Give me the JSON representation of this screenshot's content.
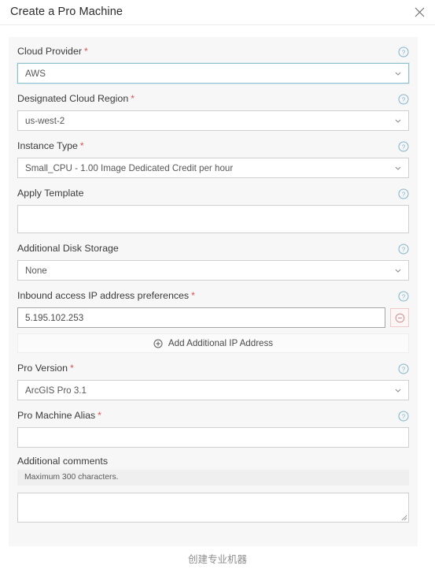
{
  "header": {
    "title": "Create a Pro Machine",
    "close_icon": "close-icon"
  },
  "colors": {
    "panel_background": "#f7f7f7",
    "page_background": "#ffffff",
    "required_asterisk": "#d9534f",
    "focused_border": "#8fc3d4",
    "help_icon": "#7fb5cc",
    "remove_button_border": "#f0c9c9",
    "remove_button_icon": "#d08a8a",
    "hint_background": "#efefef",
    "footer_text": "#8d8d8d"
  },
  "form": {
    "fields": [
      {
        "label": "Cloud Provider",
        "required": true,
        "required_mark": "*",
        "help_icon": "help-circle-icon",
        "type": "select",
        "value": "AWS",
        "focused": true
      },
      {
        "label": "Designated Cloud Region",
        "required": true,
        "required_mark": "*",
        "help_icon": "help-circle-icon",
        "type": "select",
        "value": "us-west-2",
        "focused": false
      },
      {
        "label": "Instance Type",
        "required": true,
        "required_mark": "*",
        "help_icon": "help-circle-icon",
        "type": "select",
        "value": "Small_CPU - 1.00 Image Dedicated Credit per hour",
        "focused": false
      },
      {
        "label": "Apply Template",
        "required": false,
        "required_mark": "",
        "help_icon": "help-circle-icon",
        "type": "textbox-tall",
        "value": "",
        "focused": false
      },
      {
        "label": "Additional Disk Storage",
        "required": false,
        "required_mark": "",
        "help_icon": "help-circle-icon",
        "type": "select",
        "value": "None",
        "focused": false
      }
    ],
    "ip_field": {
      "label": "Inbound access IP address preferences",
      "required": true,
      "required_mark": "*",
      "help_icon": "help-circle-icon",
      "value": "5.195.102.253",
      "remove_icon": "circle-minus-icon",
      "add_button_label": "Add Additional IP Address",
      "add_button_icon": "circle-plus-icon"
    },
    "fields_after_ip": [
      {
        "label": "Pro Version",
        "required": true,
        "required_mark": "*",
        "help_icon": "help-circle-icon",
        "type": "select",
        "value": "ArcGIS Pro 3.1",
        "focused": false
      },
      {
        "label": "Pro Machine Alias",
        "required": true,
        "required_mark": "*",
        "help_icon": "help-circle-icon",
        "type": "textbox",
        "value": "",
        "focused": false
      }
    ],
    "comments": {
      "label": "Additional comments",
      "hint": "Maximum 300 characters.",
      "value": "",
      "resize_icon": "resize-handle-icon"
    }
  },
  "footer": {
    "caption": "创建专业机器"
  }
}
